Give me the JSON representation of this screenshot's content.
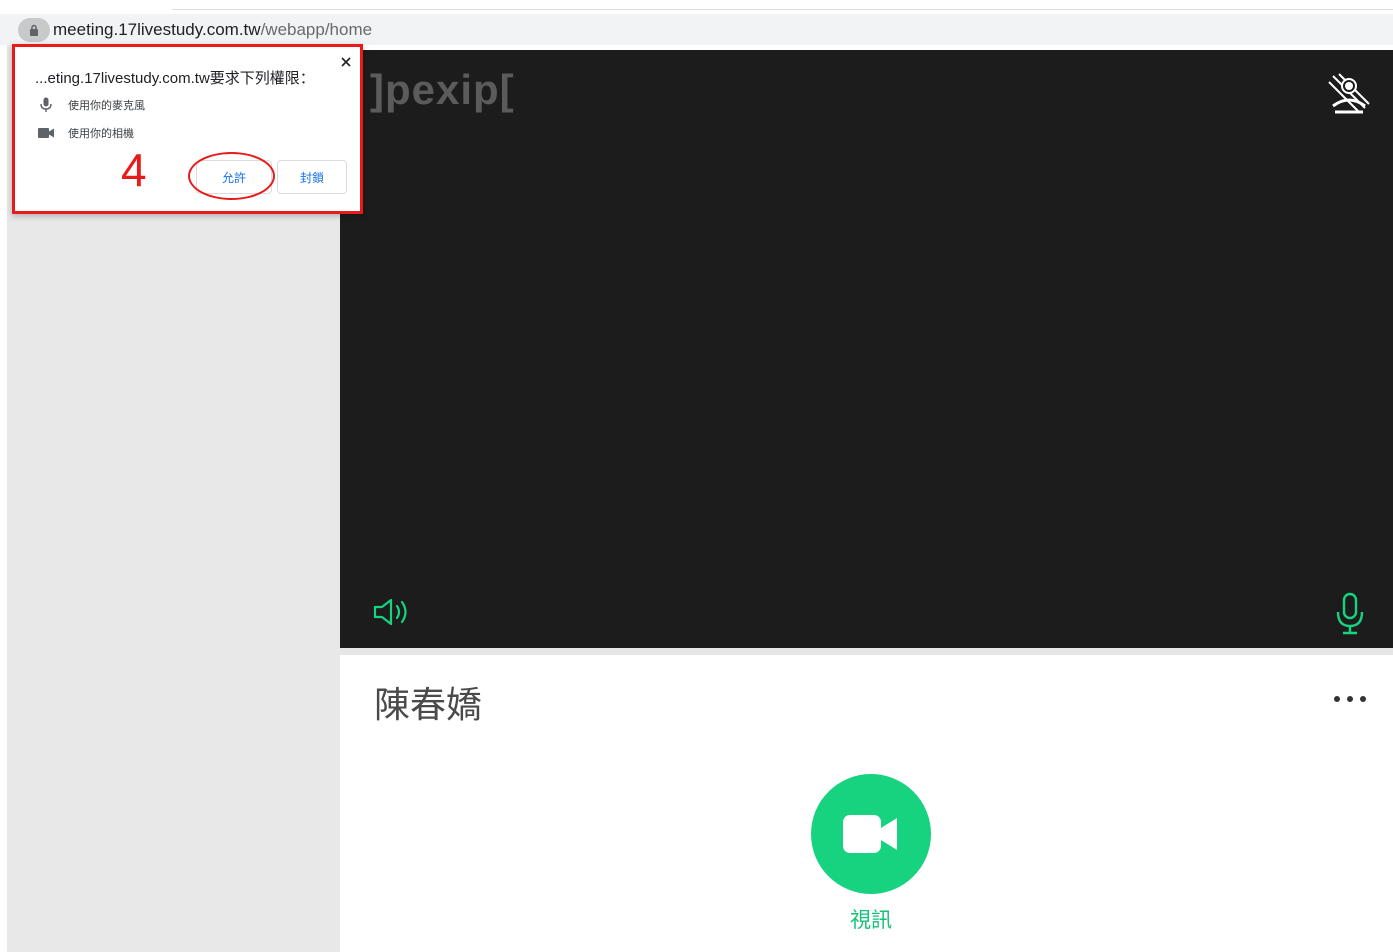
{
  "browser": {
    "url_host": "meeting.17livestudy.com.tw",
    "url_path": "/webapp/home"
  },
  "permission_popup": {
    "title": "...eting.17livestudy.com.tw要求下列權限：",
    "mic_permission": "使用你的麥克風",
    "camera_permission": "使用你的相機",
    "allow_label": "允許",
    "block_label": "封鎖",
    "step_number": "4"
  },
  "video": {
    "logo_text": "]pexip["
  },
  "caller": {
    "name": "陳春嬌"
  },
  "actions": {
    "video_call_label": "視訊"
  },
  "colors": {
    "accent_green": "#17d27e",
    "annotation_red": "#e81a1a",
    "link_blue": "#1a73e8",
    "video_bg": "#1c1c1c"
  },
  "icons": [
    "lock-icon",
    "close-icon",
    "microphone-icon",
    "camera-icon",
    "camera-off-icon",
    "speaker-icon",
    "more-icon",
    "video-camera-icon"
  ]
}
